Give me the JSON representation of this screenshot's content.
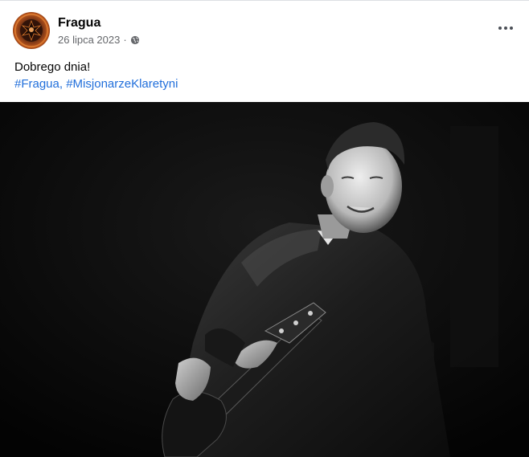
{
  "post": {
    "author": "Fragua",
    "date": "26 lipca 2023",
    "separator": "·",
    "privacy_icon": "globe-icon",
    "more_icon": "more-options-icon",
    "message": "Dobrego dnia!",
    "hashtags": [
      "#Fragua",
      "#MisjonarzeKlaretyni"
    ],
    "hashtag_separator": ", "
  },
  "photo": {
    "description_icon": "guitarist-photo",
    "style": "black-and-white"
  },
  "colors": {
    "link": "#216fdb",
    "muted": "#65676b",
    "text": "#050505"
  }
}
